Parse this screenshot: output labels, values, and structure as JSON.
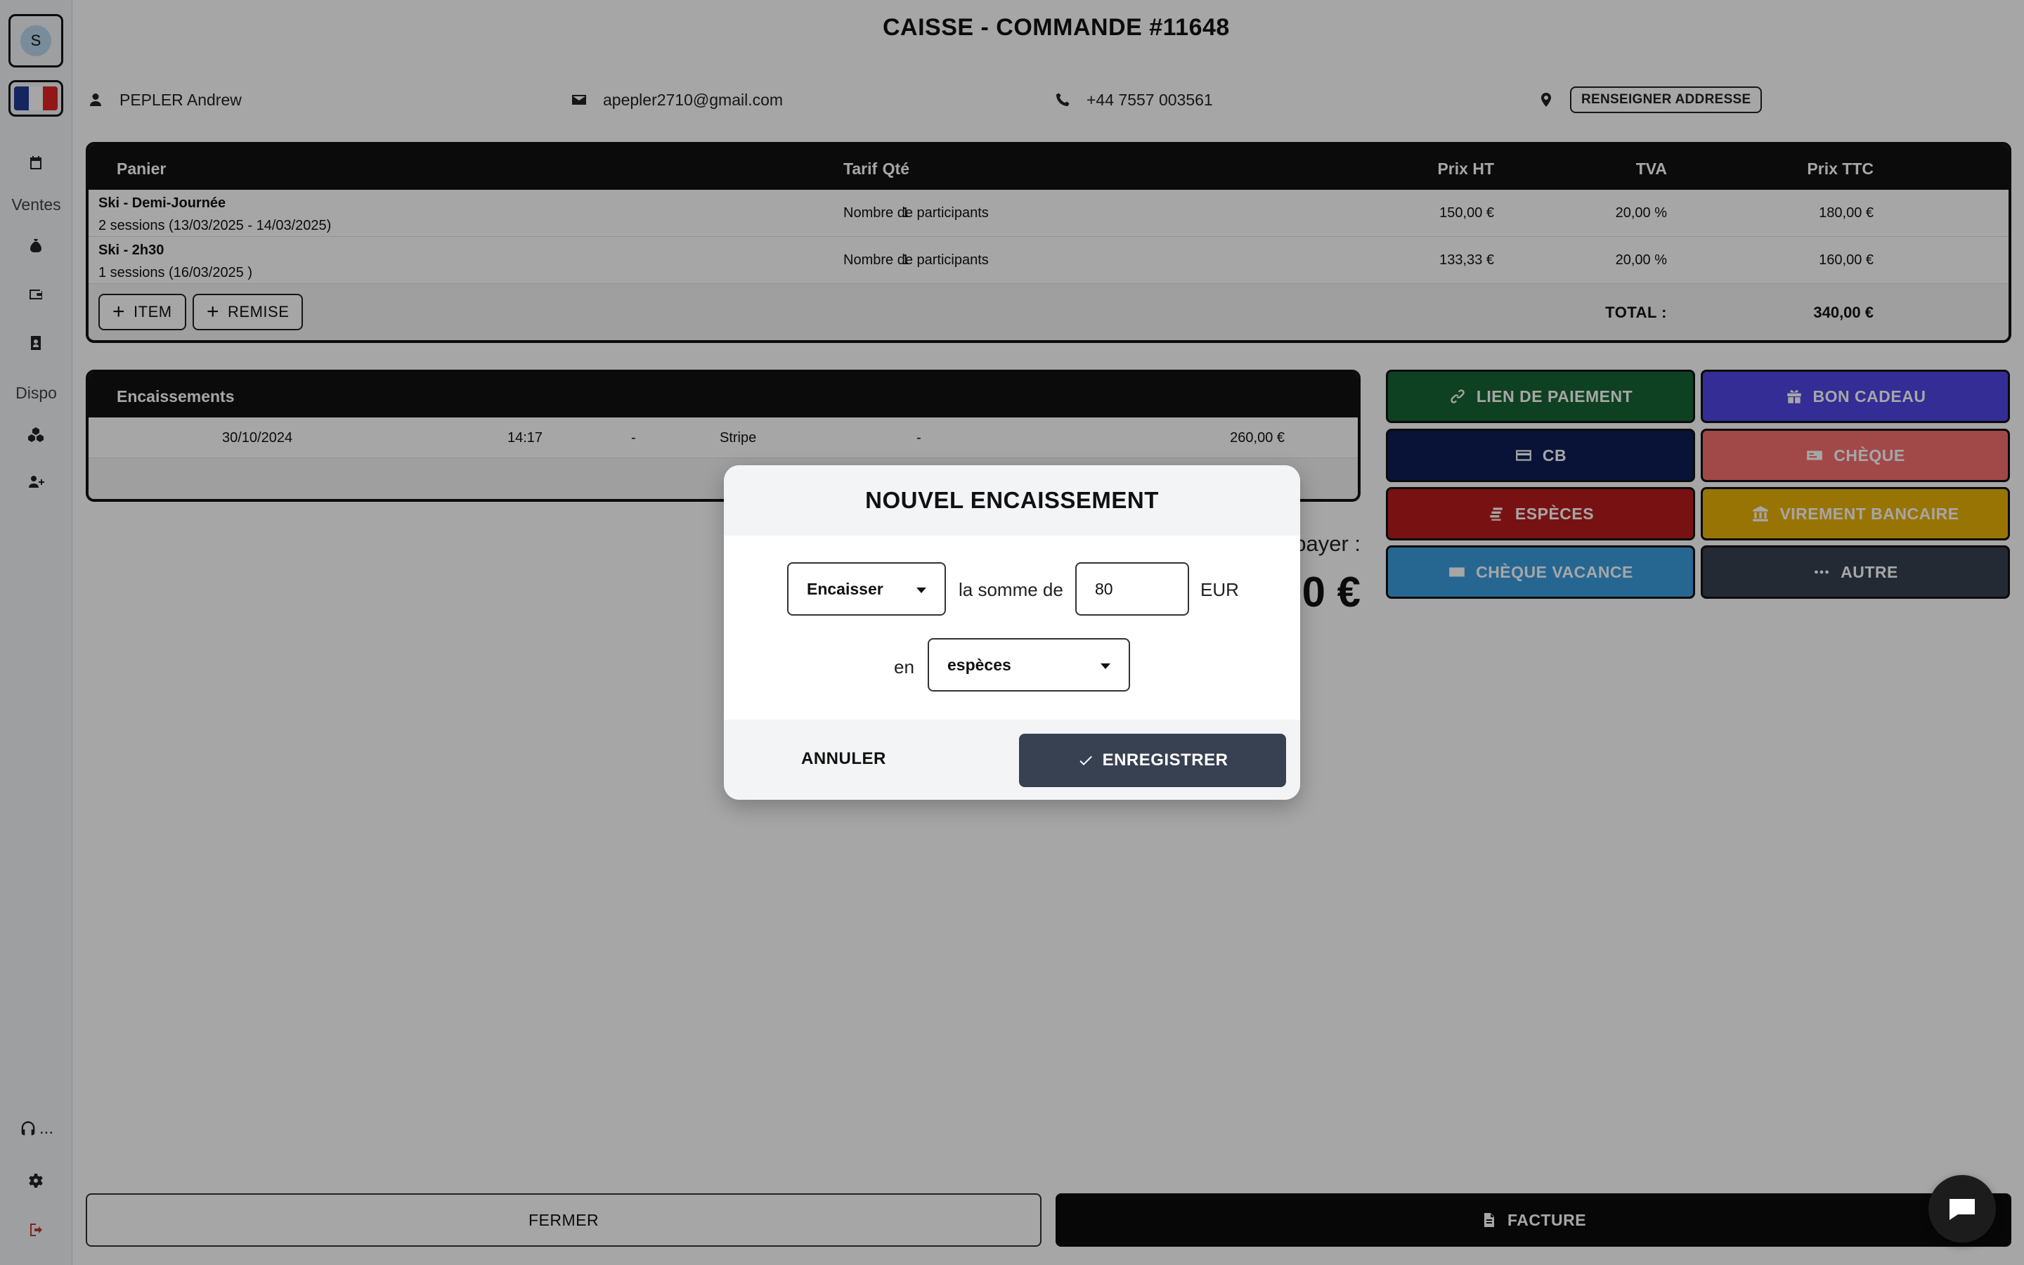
{
  "sidebar": {
    "avatar_initial": "S",
    "section_sales": "Ventes",
    "section_dispo": "Dispo",
    "more_label": "..."
  },
  "header": {
    "title": "CAISSE - COMMANDE #11648",
    "customer_name": "PEPLER Andrew",
    "email": "apepler2710@gmail.com",
    "phone": "+44 7557 003561",
    "address_button": "RENSEIGNER ADDRESSE"
  },
  "cart": {
    "headers": {
      "item": "Panier",
      "qty": "Qté",
      "tariff": "Tarif",
      "price_ht": "Prix HT",
      "vat": "TVA",
      "price_ttc": "Prix TTC"
    },
    "rows": [
      {
        "name": "Ski - Demi-Journée",
        "sessions": "2 sessions (13/03/2025 - 14/03/2025)",
        "qty": "1",
        "tariff": "Nombre de participants",
        "price_ht": "150,00 €",
        "vat": "20,00 %",
        "price_ttc": "180,00 €"
      },
      {
        "name": "Ski - 2h30",
        "sessions": "1 sessions (16/03/2025 )",
        "qty": "1",
        "tariff": "Nombre de participants",
        "price_ht": "133,33 €",
        "vat": "20,00 %",
        "price_ttc": "160,00 €"
      }
    ],
    "add_item": "ITEM",
    "add_discount": "REMISE",
    "total_label": "TOTAL :",
    "total_value": "340,00 €"
  },
  "payments": {
    "header": "Encaissements",
    "rows": [
      {
        "date": "30/10/2024",
        "time": "14:17",
        "col3": "-",
        "method": "Stripe",
        "col5": "-",
        "amount": "260,00 €"
      }
    ],
    "to_pay_label": "payer :",
    "to_pay_value": "0 €"
  },
  "payment_methods": [
    {
      "label": "LIEN DE PAIEMENT",
      "icon": "link-icon",
      "color": "#166534"
    },
    {
      "label": "BON CADEAU",
      "icon": "gift-icon",
      "color": "#4f46e5"
    },
    {
      "label": "CB",
      "icon": "credit-card-icon",
      "color": "#0f1e57"
    },
    {
      "label": "CHÈQUE",
      "icon": "cheque-icon",
      "color": "#f87171"
    },
    {
      "label": "ESPÈCES",
      "icon": "coins-icon",
      "color": "#b91c1c"
    },
    {
      "label": "VIREMENT BANCAIRE",
      "icon": "bank-icon",
      "color": "#eab308"
    },
    {
      "label": "CHÈQUE VACANCE",
      "icon": "voucher-icon",
      "color": "#3b9fe0"
    },
    {
      "label": "AUTRE",
      "icon": "more-icon",
      "color": "#374151"
    }
  ],
  "footer": {
    "close": "FERMER",
    "invoice": "FACTURE"
  },
  "modal": {
    "title": "NOUVEL ENCAISSEMENT",
    "action_select": "Encaisser",
    "amount_prefix": "la somme de",
    "amount_value": "80",
    "currency": "EUR",
    "method_prefix": "en",
    "method_select": "espèces",
    "cancel": "ANNULER",
    "save": "ENREGISTRER"
  }
}
